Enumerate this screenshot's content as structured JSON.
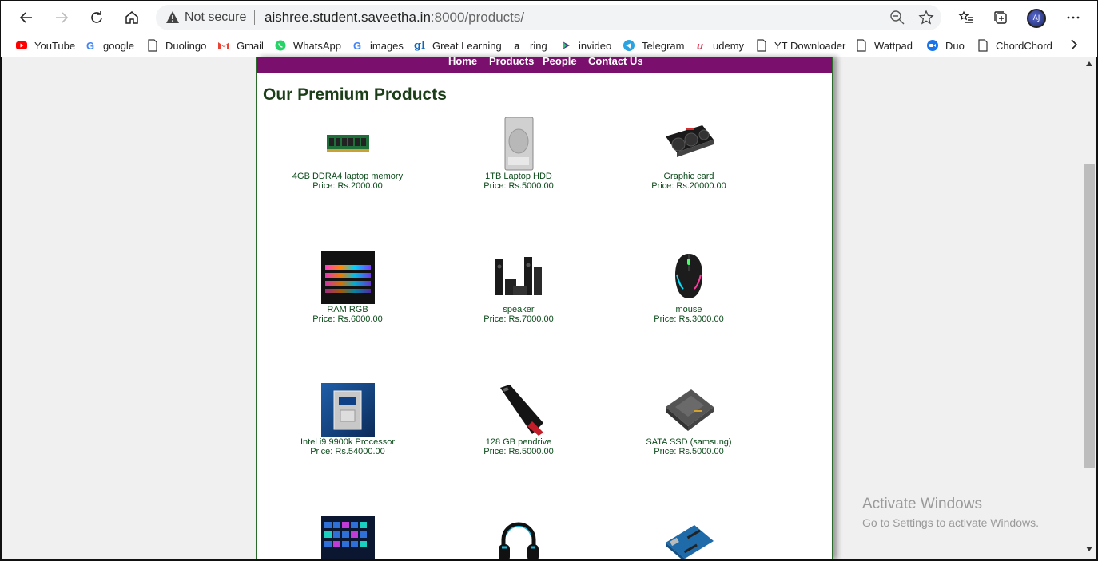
{
  "browser": {
    "security_label": "Not secure",
    "url_host": "aishree.student.saveetha.in",
    "url_path": ":8000/products/",
    "icons": {
      "back": "back-arrow-icon",
      "forward": "forward-arrow-icon",
      "refresh": "refresh-icon",
      "home": "home-icon",
      "zoom": "zoom-out-icon",
      "favorite": "star-icon",
      "favorites_bar": "favorites-list-icon",
      "collections": "collections-icon",
      "profile": "profile-avatar",
      "menu": "more-dots-icon"
    },
    "profile_initials": "AJ"
  },
  "bookmarks": [
    {
      "label": "YouTube",
      "icon": "youtube-icon",
      "color": "#ff0000"
    },
    {
      "label": "google",
      "icon": "google-icon",
      "color": "#4285f4"
    },
    {
      "label": "Duolingo",
      "icon": "page-icon",
      "color": "#333333"
    },
    {
      "label": "Gmail",
      "icon": "gmail-icon",
      "color": "#ea4335"
    },
    {
      "label": "WhatsApp",
      "icon": "whatsapp-icon",
      "color": "#25d366"
    },
    {
      "label": "images",
      "icon": "google-icon",
      "color": "#4285f4"
    },
    {
      "label": "Great Learning",
      "icon": "great-learning-icon",
      "color": "#0a66c2"
    },
    {
      "label": "ring",
      "icon": "amazon-icon",
      "color": "#222222"
    },
    {
      "label": "invideo",
      "icon": "invideo-icon",
      "color": "#3b3b7a"
    },
    {
      "label": "Telegram",
      "icon": "telegram-icon",
      "color": "#2aa3e0"
    },
    {
      "label": "udemy",
      "icon": "udemy-icon",
      "color": "#d53d56"
    },
    {
      "label": "YT Downloader",
      "icon": "page-icon",
      "color": "#333333"
    },
    {
      "label": "Wattpad",
      "icon": "page-icon",
      "color": "#333333"
    },
    {
      "label": "Duo",
      "icon": "duo-icon",
      "color": "#1a73e8"
    },
    {
      "label": "ChordChord",
      "icon": "page-icon",
      "color": "#333333"
    }
  ],
  "site": {
    "nav": [
      "Home",
      "Products",
      "People",
      "Contact Us"
    ],
    "nav_color": "#7b0f6e",
    "title": "Our Premium Products",
    "title_color": "#1b3e18"
  },
  "products": [
    {
      "name": "4GB DDRA4 laptop memory",
      "price": "Price: Rs.2000.00",
      "icon": "ram-stick-image"
    },
    {
      "name": "1TB Laptop HDD",
      "price": "Price: Rs.5000.00",
      "icon": "hard-drive-image"
    },
    {
      "name": "Graphic card",
      "price": "Price: Rs.20000.00",
      "icon": "graphics-card-image"
    },
    {
      "name": "RAM RGB",
      "price": "Price: Rs.6000.00",
      "icon": "rgb-ram-image"
    },
    {
      "name": "speaker",
      "price": "Price: Rs.7000.00",
      "icon": "speaker-set-image"
    },
    {
      "name": "mouse",
      "price": "Price: Rs.3000.00",
      "icon": "gaming-mouse-image"
    },
    {
      "name": "Intel i9 9900k Processor",
      "price": "Price: Rs.54000.00",
      "icon": "processor-image"
    },
    {
      "name": "128 GB pendrive",
      "price": "Price: Rs.5000.00",
      "icon": "pendrive-image"
    },
    {
      "name": "SATA SSD (samsung)",
      "price": "Price: Rs.5000.00",
      "icon": "ssd-image"
    },
    {
      "name": "",
      "price": "",
      "icon": "keyboard-image"
    },
    {
      "name": "",
      "price": "",
      "icon": "headphones-image"
    },
    {
      "name": "",
      "price": "",
      "icon": "arduino-board-image"
    }
  ],
  "watermark": {
    "title": "Activate Windows",
    "subtitle": "Go to Settings to activate Windows."
  }
}
